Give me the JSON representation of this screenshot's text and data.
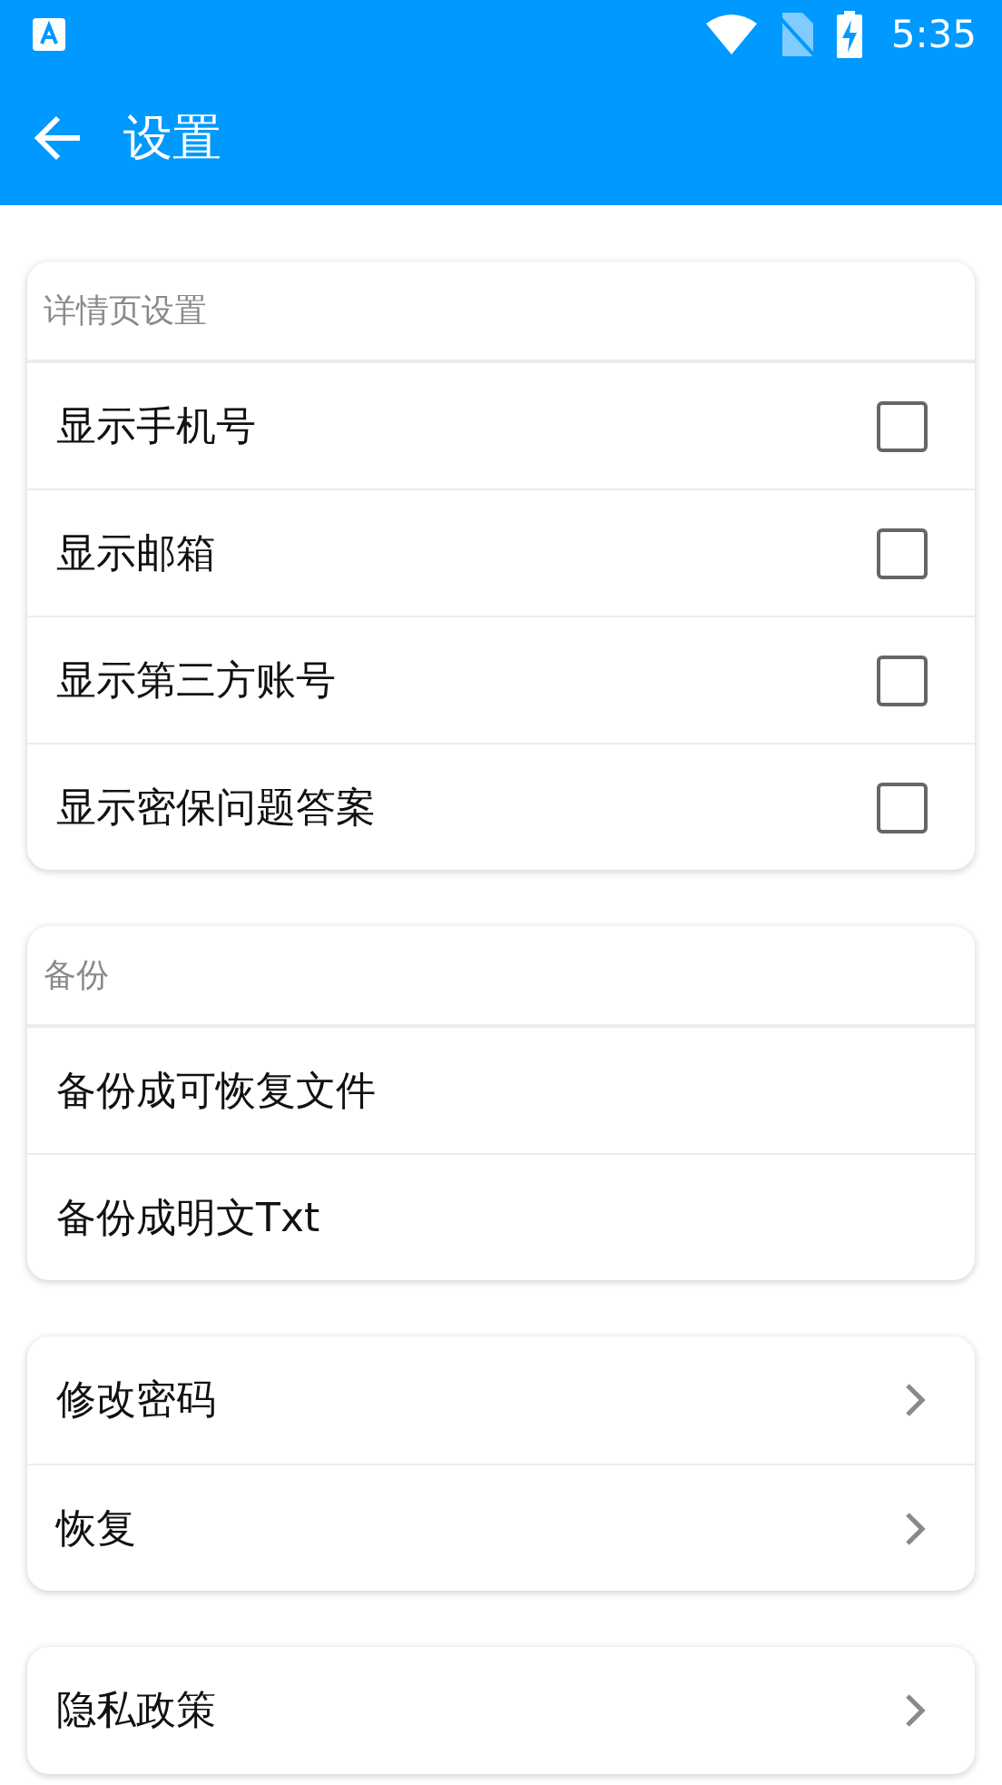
{
  "status_bar": {
    "time": "5:35"
  },
  "app_bar": {
    "title": "设置"
  },
  "sections": [
    {
      "header": "详情页设置",
      "items": [
        {
          "kind": "checkbox",
          "label": "显示手机号",
          "checked": false
        },
        {
          "kind": "checkbox",
          "label": "显示邮箱",
          "checked": false
        },
        {
          "kind": "checkbox",
          "label": "显示第三方账号",
          "checked": false
        },
        {
          "kind": "checkbox",
          "label": "显示密保问题答案",
          "checked": false
        }
      ]
    },
    {
      "header": "备份",
      "items": [
        {
          "kind": "plain",
          "label": "备份成可恢复文件"
        },
        {
          "kind": "plain",
          "label": "备份成明文Txt"
        }
      ]
    },
    {
      "items": [
        {
          "kind": "link",
          "label": "修改密码"
        },
        {
          "kind": "link",
          "label": "恢复"
        }
      ]
    },
    {
      "items": [
        {
          "kind": "link",
          "label": "隐私政策"
        }
      ]
    }
  ]
}
